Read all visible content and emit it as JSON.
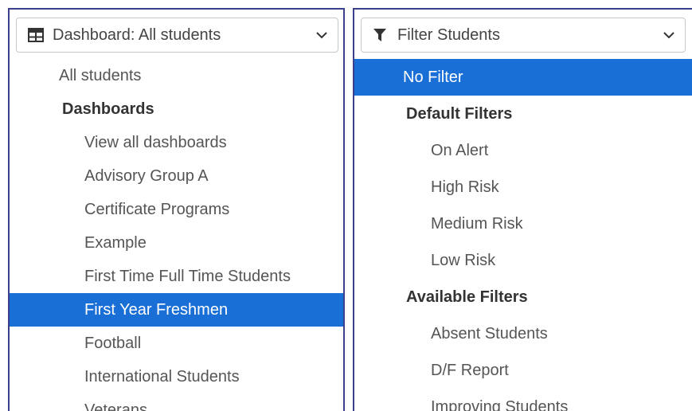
{
  "dashboard_dropdown": {
    "header_label": "Dashboard: All students",
    "icon": "grid-icon",
    "root_item": "All students",
    "group_label": "Dashboards",
    "items": [
      {
        "label": "View all dashboards",
        "selected": false
      },
      {
        "label": "Advisory Group A",
        "selected": false
      },
      {
        "label": "Certificate Programs",
        "selected": false
      },
      {
        "label": "Example",
        "selected": false
      },
      {
        "label": "First Time Full Time Students",
        "selected": false
      },
      {
        "label": "First Year Freshmen",
        "selected": true
      },
      {
        "label": "Football",
        "selected": false
      },
      {
        "label": "International Students",
        "selected": false
      },
      {
        "label": "Veterans",
        "selected": false
      }
    ]
  },
  "filter_dropdown": {
    "header_label": "Filter Students",
    "icon": "filter-icon",
    "root_item": "No Filter",
    "root_selected": true,
    "default_group_label": "Default Filters",
    "default_items": [
      "On Alert",
      "High Risk",
      "Medium Risk",
      "Low Risk"
    ],
    "available_group_label": "Available Filters",
    "available_items": [
      "Absent Students",
      "D/F Report",
      "Improving Students"
    ]
  },
  "colors": {
    "selection": "#1a6fd6",
    "panel_border": "#3b3f8c"
  }
}
